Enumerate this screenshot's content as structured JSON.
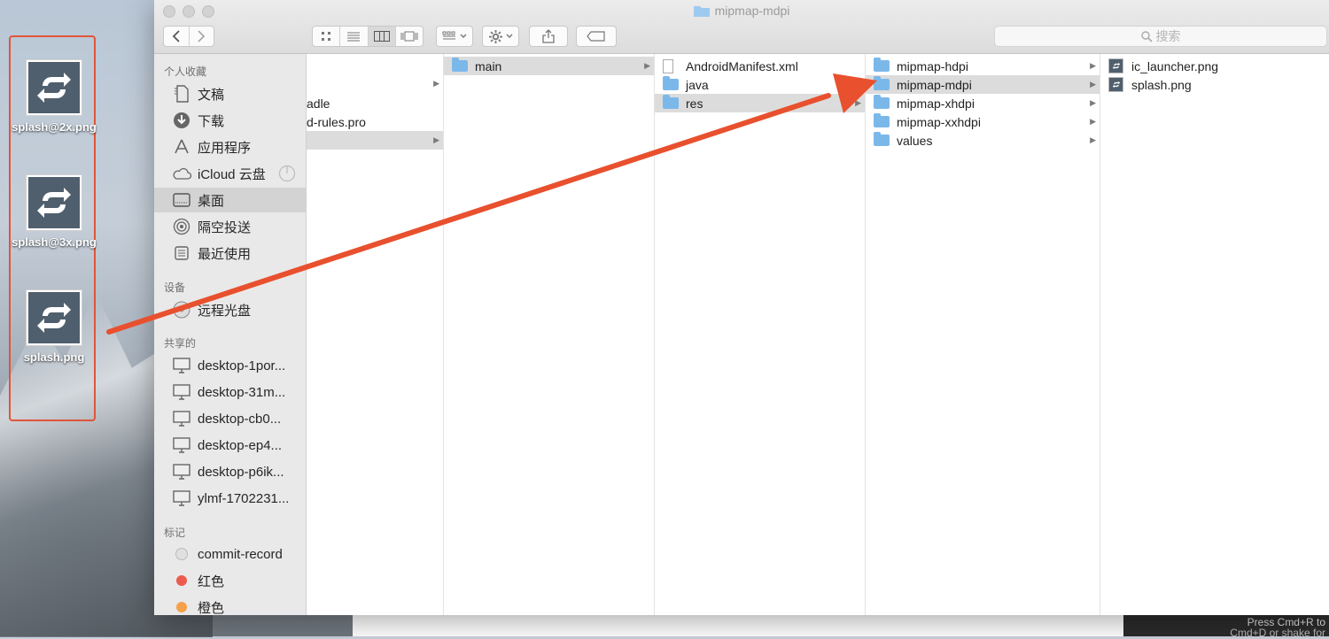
{
  "desktop": {
    "icons": [
      {
        "label": "splash@2x.png"
      },
      {
        "label": "splash@3x.png"
      },
      {
        "label": "splash.png"
      }
    ],
    "overlay_line1": "Press Cmd+R to",
    "overlay_line2": "Cmd+D or shake for"
  },
  "window": {
    "title": "mipmap-mdpi",
    "search_placeholder": "搜索"
  },
  "sidebar": {
    "favorites_header": "个人收藏",
    "favorites": [
      {
        "label": "文稿",
        "icon": "document-icon"
      },
      {
        "label": "下载",
        "icon": "download-icon"
      },
      {
        "label": "应用程序",
        "icon": "applications-icon"
      },
      {
        "label": "iCloud 云盘",
        "icon": "cloud-icon"
      },
      {
        "label": "桌面",
        "icon": "desktop-icon"
      },
      {
        "label": "隔空投送",
        "icon": "airdrop-icon"
      },
      {
        "label": "最近使用",
        "icon": "recent-icon"
      }
    ],
    "devices_header": "设备",
    "devices": [
      {
        "label": "远程光盘",
        "icon": "disc-icon"
      }
    ],
    "shared_header": "共享的",
    "shared": [
      {
        "label": "desktop-1por..."
      },
      {
        "label": "desktop-31m..."
      },
      {
        "label": "desktop-cb0..."
      },
      {
        "label": "desktop-ep4..."
      },
      {
        "label": "desktop-p6ik..."
      },
      {
        "label": "ylmf-1702231..."
      }
    ],
    "tags_header": "标记",
    "tags": [
      {
        "label": "commit-record",
        "color": "#d8d8d8"
      },
      {
        "label": "红色",
        "color": "#ec5b4f"
      },
      {
        "label": "橙色",
        "color": "#f5a14a"
      }
    ]
  },
  "columns": {
    "col1": [
      {
        "label": ""
      },
      {
        "label": "adle"
      },
      {
        "label": "d-rules.pro"
      },
      {
        "label": ""
      }
    ],
    "col2": [
      {
        "label": "main"
      }
    ],
    "col3": [
      {
        "label": "AndroidManifest.xml"
      },
      {
        "label": "java"
      },
      {
        "label": "res"
      }
    ],
    "col4": [
      {
        "label": "mipmap-hdpi"
      },
      {
        "label": "mipmap-mdpi"
      },
      {
        "label": "mipmap-xhdpi"
      },
      {
        "label": "mipmap-xxhdpi"
      },
      {
        "label": "values"
      }
    ],
    "col5": [
      {
        "label": "ic_launcher.png"
      },
      {
        "label": "splash.png"
      }
    ]
  },
  "colors": {
    "annotation_red": "#e8502e",
    "folder_blue": "#7bb8ea",
    "selection_gray": "#dcdcdc"
  }
}
